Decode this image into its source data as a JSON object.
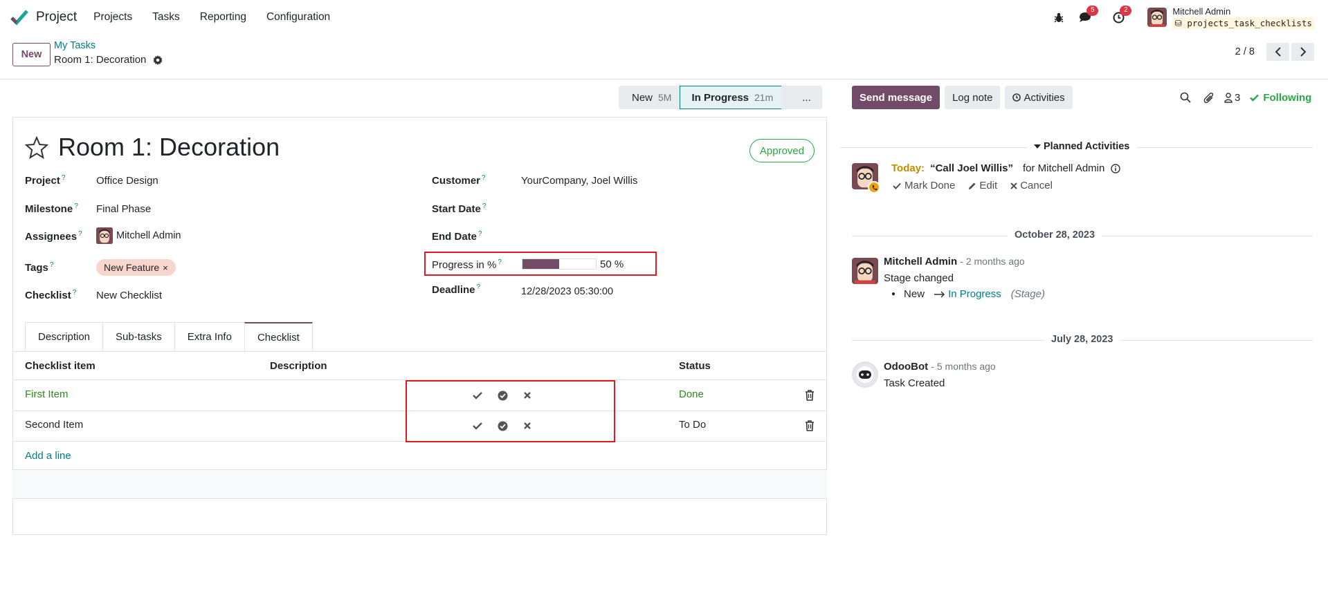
{
  "navbar": {
    "app_name": "Project",
    "menu": [
      "Projects",
      "Tasks",
      "Reporting",
      "Configuration"
    ],
    "messages_count": "5",
    "activities_count": "2",
    "user_name": "Mitchell Admin",
    "database": "projects_task_checklists"
  },
  "control_panel": {
    "new_label": "New",
    "breadcrumb_parent": "My Tasks",
    "breadcrumb_current": "Room 1: Decoration",
    "pager": "2 / 8"
  },
  "statusbar": {
    "stages": [
      {
        "label": "New",
        "duration": "5M"
      },
      {
        "label": "In Progress",
        "duration": "21m"
      },
      {
        "label": "..."
      }
    ]
  },
  "form": {
    "title": "Room 1: Decoration",
    "approved": "Approved",
    "left_fields": [
      {
        "label": "Project",
        "value": "Office Design"
      },
      {
        "label": "Milestone",
        "value": "Final Phase"
      },
      {
        "label": "Assignees",
        "value": "Mitchell Admin"
      },
      {
        "label": "Tags",
        "value": "New Feature"
      },
      {
        "label": "Checklist",
        "value": "New Checklist"
      }
    ],
    "right_fields": [
      {
        "label": "Customer",
        "value": "YourCompany, Joel Willis"
      },
      {
        "label": "Start Date",
        "value": ""
      },
      {
        "label": "End Date",
        "value": ""
      },
      {
        "label": "Progress in %",
        "value": "50 %",
        "progress": 0.5
      },
      {
        "label": "Deadline",
        "value": "12/28/2023 05:30:00"
      }
    ],
    "help_mark": "?",
    "tabs": [
      "Description",
      "Sub-tasks",
      "Extra Info",
      "Checklist"
    ],
    "active_tab": "Checklist",
    "table_headers": [
      "Checklist item",
      "Description",
      "Status"
    ],
    "rows": [
      {
        "item": "First Item",
        "description": "",
        "status": "Done"
      },
      {
        "item": "Second Item",
        "description": "",
        "status": "To Do"
      }
    ],
    "add_line": "Add a line"
  },
  "chatter": {
    "send_message": "Send message",
    "log_note": "Log note",
    "activities": "Activities",
    "followers_count": "3",
    "following": "Following",
    "planned_title": "Planned Activities",
    "activity": {
      "when": "Today:",
      "summary": "“Call Joel Willis”",
      "for": "for Mitchell Admin",
      "mark_done": "Mark Done",
      "edit": "Edit",
      "cancel": "Cancel"
    },
    "dates": [
      "October 28, 2023",
      "July 28, 2023"
    ],
    "messages": [
      {
        "author": "Mitchell Admin",
        "time": "- 2 months ago",
        "body": "Stage changed",
        "from": "New",
        "to": "In Progress",
        "field": "(Stage)"
      },
      {
        "author": "OdooBot",
        "time": "- 5 months ago",
        "body": "Task Created"
      }
    ]
  },
  "colors": {
    "brand": "#714B67",
    "teal": "#017e84",
    "success": "#28a745",
    "highlight_box": "#e0181f"
  }
}
